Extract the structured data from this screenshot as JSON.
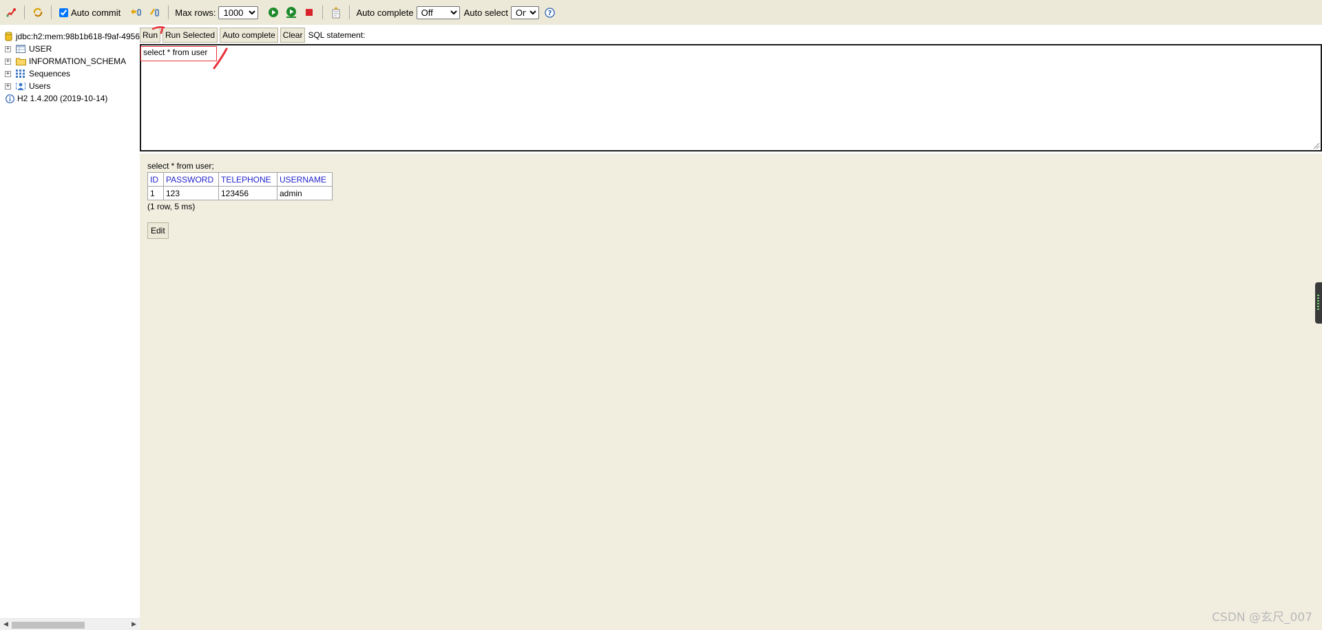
{
  "toolbar": {
    "auto_commit_label": "Auto commit",
    "auto_commit_checked": true,
    "max_rows_label": "Max rows:",
    "max_rows_value": "1000",
    "auto_complete_label": "Auto complete",
    "auto_complete_value": "Off",
    "auto_select_label": "Auto select",
    "auto_select_value": "On",
    "icons": [
      "disconnect-icon",
      "refresh-icon",
      "rollback-icon",
      "commit-icon",
      "run-icon",
      "run-selected-icon",
      "stop-icon",
      "history-icon",
      "help-icon"
    ]
  },
  "tree": {
    "connection": "jdbc:h2:mem:98b1b618-f9af-4956",
    "items": [
      {
        "label": "USER",
        "icon": "table-icon"
      },
      {
        "label": "INFORMATION_SCHEMA",
        "icon": "folder-icon"
      },
      {
        "label": "Sequences",
        "icon": "sequence-icon"
      },
      {
        "label": "Users",
        "icon": "users-icon"
      }
    ],
    "version": "H2 1.4.200 (2019-10-14)"
  },
  "query": {
    "buttons": {
      "run": "Run",
      "run_selected": "Run Selected",
      "auto_complete": "Auto complete",
      "clear": "Clear"
    },
    "caption": "SQL statement:",
    "sql_text": "select * from user"
  },
  "result": {
    "statement": "select * from user;",
    "columns": [
      "ID",
      "PASSWORD",
      "TELEPHONE",
      "USERNAME"
    ],
    "rows": [
      [
        "1",
        "123",
        "123456",
        "admin"
      ]
    ],
    "info": "(1 row, 5 ms)",
    "edit_label": "Edit"
  },
  "colors": {
    "toolbar_bg": "#ece9d8",
    "result_bg": "#f1eee0",
    "header_text": "#2222cc",
    "annotation": "#e9313a"
  },
  "watermark": "CSDN @玄尺_007"
}
